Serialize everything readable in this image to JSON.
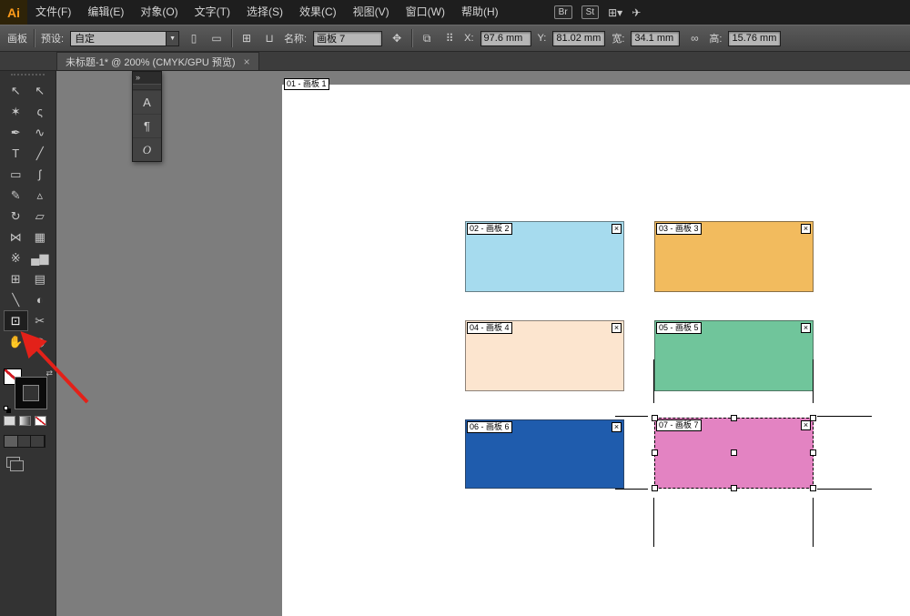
{
  "ui": {
    "close_glyph": "×",
    "dropdown_arrow": "▼"
  },
  "menubar": {
    "logo": "Ai",
    "items": [
      "文件(F)",
      "编辑(E)",
      "对象(O)",
      "文字(T)",
      "选择(S)",
      "效果(C)",
      "视图(V)",
      "窗口(W)",
      "帮助(H)"
    ],
    "br": "Br",
    "st": "St",
    "workspace_glyph": "⊞▾",
    "share_glyph": "✈"
  },
  "control_bar": {
    "panel_label": "画板",
    "preset_label": "预设:",
    "preset_value": "自定",
    "name_label": "名称:",
    "name_value": "画板 7",
    "x_label": "X:",
    "x_value": "97.6 mm",
    "y_label": "Y:",
    "y_value": "81.02 mm",
    "w_label": "宽:",
    "w_value": "34.1 mm",
    "h_label": "高:",
    "h_value": "15.76 mm",
    "icons": {
      "portrait": "▯",
      "landscape": "▭",
      "new_artboard": "⊞",
      "delete_artboard": "⊔",
      "artboard_options": "✥",
      "move_artwork": "⧉",
      "reference_point": "⠿",
      "link": "∞"
    }
  },
  "tabbar": {
    "title": "未标题-1* @ 200% (CMYK/GPU 预览)"
  },
  "tools": [
    {
      "name": "selection-tool",
      "glyph": "↖"
    },
    {
      "name": "direct-selection-tool",
      "glyph": "↖"
    },
    {
      "name": "magic-wand-tool",
      "glyph": "✶"
    },
    {
      "name": "lasso-tool",
      "glyph": "ς"
    },
    {
      "name": "pen-tool",
      "glyph": "✒"
    },
    {
      "name": "curvature-tool",
      "glyph": "∿"
    },
    {
      "name": "type-tool",
      "glyph": "T"
    },
    {
      "name": "line-segment-tool",
      "glyph": "╱"
    },
    {
      "name": "rectangle-tool",
      "glyph": "▭"
    },
    {
      "name": "paintbrush-tool",
      "glyph": "ʃ"
    },
    {
      "name": "pencil-tool",
      "glyph": "✎"
    },
    {
      "name": "shaper-tool",
      "glyph": "▵"
    },
    {
      "name": "rotate-tool",
      "glyph": "↻"
    },
    {
      "name": "scale-tool",
      "glyph": "▱"
    },
    {
      "name": "width-tool",
      "glyph": "⋈"
    },
    {
      "name": "free-transform-tool",
      "glyph": "▦"
    },
    {
      "name": "symbol-sprayer-tool",
      "glyph": "※"
    },
    {
      "name": "graph-tool",
      "glyph": "▄▆"
    },
    {
      "name": "mesh-tool",
      "glyph": "⊞"
    },
    {
      "name": "gradient-tool",
      "glyph": "▤"
    },
    {
      "name": "eyedropper-tool",
      "glyph": "╲"
    },
    {
      "name": "blend-tool",
      "glyph": "◐"
    },
    {
      "name": "artboard-tool",
      "glyph": "⊡",
      "active": true
    },
    {
      "name": "slice-tool",
      "glyph": "✂"
    },
    {
      "name": "hand-tool",
      "glyph": "✋"
    },
    {
      "name": "zoom-tool",
      "glyph": "◎"
    }
  ],
  "toolbox": {
    "swap_glyph": "⇄"
  },
  "float_panel": {
    "collapse": "»",
    "buttons": [
      {
        "name": "character-panel-button",
        "glyph": "A"
      },
      {
        "name": "paragraph-panel-button",
        "glyph": "¶"
      },
      {
        "name": "opentype-panel-button",
        "glyph": "O"
      }
    ]
  },
  "canvas": {
    "page_label": "01 - 画板 1",
    "boards": [
      {
        "label": "02 - 画板 2",
        "color": "#a6dbee"
      },
      {
        "label": "03 - 画板 3",
        "color": "#f2bb5e"
      },
      {
        "label": "04 - 画板 4",
        "color": "#fce5cf"
      },
      {
        "label": "05 - 画板 5",
        "color": "#70c59b"
      },
      {
        "label": "06 - 画板 6",
        "color": "#1f5cad"
      },
      {
        "label": "07 - 画板 7",
        "color": "#e383c2"
      }
    ]
  },
  "annotation": {
    "arrow_color": "#e32119"
  }
}
